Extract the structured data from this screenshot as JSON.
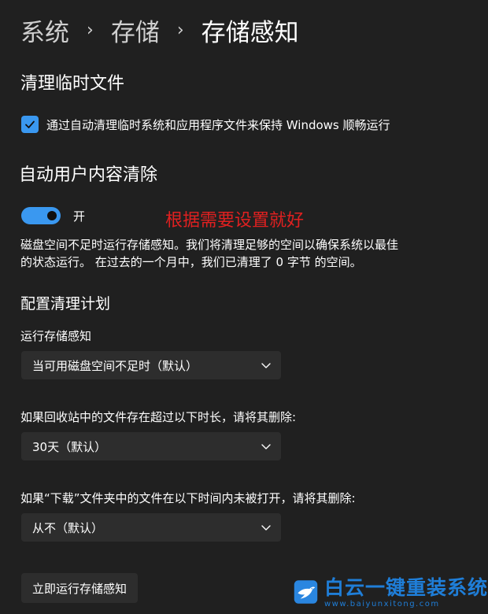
{
  "breadcrumb": {
    "items": [
      "系统",
      "存储",
      "存储感知"
    ],
    "separator": "›"
  },
  "temp_files": {
    "heading": "清理临时文件",
    "checkbox_label": "通过自动清理临时系统和应用程序文件来保持 Windows 顺畅运行",
    "checked": true
  },
  "auto_clean": {
    "heading": "自动用户内容清除",
    "toggle_label": "开",
    "toggle_on": true,
    "description_line1": "磁盘空间不足时运行存储感知。我们将清理足够的空间以确保系统以最佳",
    "description_line2": "的状态运行。 在过去的一个月中，我们已清理了 0 字节 的空间。"
  },
  "annotation": "根据需要设置就好",
  "schedule": {
    "heading": "配置清理计划",
    "run_label": "运行存储感知",
    "run_value": "当可用磁盘空间不足时（默认）",
    "recycle_label": "如果回收站中的文件存在超过以下时长，请将其删除:",
    "recycle_value": "30天（默认）",
    "downloads_label": "如果“下载”文件夹中的文件在以下时间内未被打开，请将其删除:",
    "downloads_value": "从不（默认）"
  },
  "run_now_button": "立即运行存储感知",
  "watermark": {
    "text_cn": "白云一键重装系统",
    "text_en": "www.baiyunxitong.com"
  },
  "colors": {
    "accent": "#3a98f0",
    "background": "#202020",
    "control": "#2d2d2d",
    "annotation": "#e02020",
    "watermark": "#1f7ed8"
  }
}
